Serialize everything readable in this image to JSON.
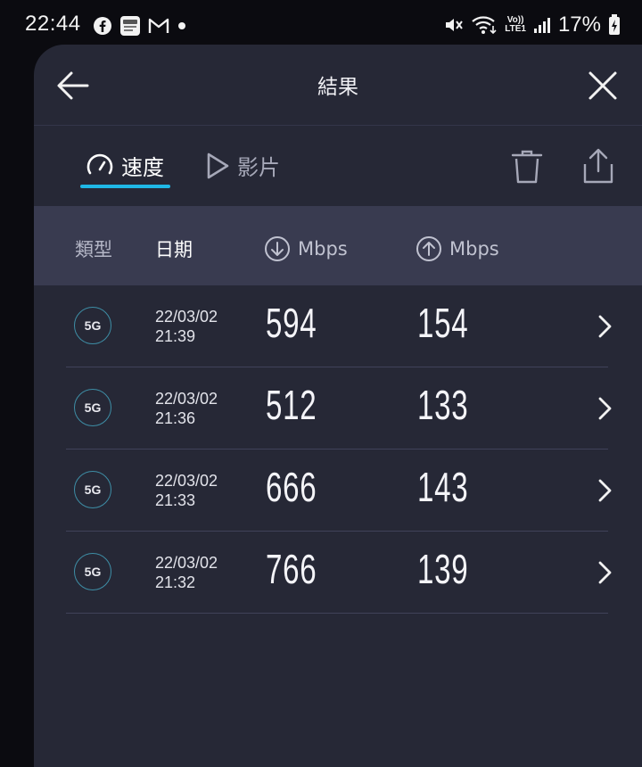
{
  "status_bar": {
    "time": "22:44",
    "battery_percent": "17%",
    "network_label_top": "Vo))",
    "network_label_bottom": "LTE1",
    "left_icons": [
      "facebook-icon",
      "app-icon",
      "gmail-icon",
      "dot-icon"
    ],
    "right_icons": [
      "mute-icon",
      "wifi-icon",
      "signal-icon",
      "battery-icon"
    ]
  },
  "header": {
    "title": "結果"
  },
  "tabs": [
    {
      "label": "速度",
      "icon": "speedometer-icon",
      "active": true
    },
    {
      "label": "影片",
      "icon": "play-icon",
      "active": false
    }
  ],
  "table": {
    "columns": {
      "type": "類型",
      "date": "日期",
      "download": "Mbps",
      "upload": "Mbps"
    },
    "rows": [
      {
        "type": "5G",
        "date": "22/03/02",
        "time": "21:39",
        "download": "594",
        "upload": "154"
      },
      {
        "type": "5G",
        "date": "22/03/02",
        "time": "21:36",
        "download": "512",
        "upload": "133"
      },
      {
        "type": "5G",
        "date": "22/03/02",
        "time": "21:33",
        "download": "666",
        "upload": "143"
      },
      {
        "type": "5G",
        "date": "22/03/02",
        "time": "21:32",
        "download": "766",
        "upload": "139"
      }
    ]
  },
  "colors": {
    "panel_bg": "#262836",
    "header_row_bg": "#393b50",
    "accent": "#1fb8e6",
    "badge_ring": "#3e8ea6"
  }
}
